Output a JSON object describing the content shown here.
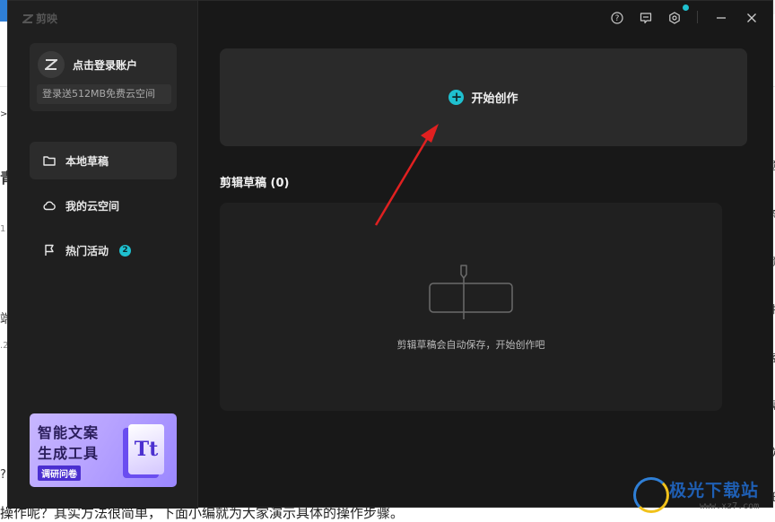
{
  "app": {
    "brand": "剪映",
    "login": {
      "title": "点击登录账户",
      "subtitle": "登录送512MB免费云空间"
    },
    "nav": [
      {
        "label": "本地草稿",
        "icon": "folder-icon"
      },
      {
        "label": "我的云空间",
        "icon": "cloud-icon"
      },
      {
        "label": "热门活动",
        "icon": "flag-icon",
        "badge": "2"
      }
    ],
    "promo": {
      "line1": "智能文案",
      "line2": "生成工具",
      "line3": "调研问卷",
      "glyph": "Tt"
    },
    "top_controls": [
      "help-icon",
      "feedback-icon",
      "settings-icon",
      "minimize-icon",
      "close-icon"
    ],
    "create": {
      "label": "开始创作"
    },
    "drafts": {
      "title": "剪辑草稿 (0)",
      "empty": "剪辑草稿会自动保存，开始创作吧"
    }
  },
  "background_page": {
    "bottom_text": "操作呢？其实方法很简单，下面小编就为大家演示具体的操作步骤。",
    "right_edge_chars": [
      "题",
      "条",
      "频",
      "件",
      "客",
      "视",
      "软",
      "任",
      "件",
      "器"
    ],
    "left_edge_chars": [
      ">",
      "青",
      "1",
      "端",
      ".2",
      "?"
    ]
  },
  "watermark": {
    "title": "极光下载站",
    "url": "www.xz7.com"
  },
  "colors": {
    "accent": "#1fc0cf",
    "window_bg": "#181818",
    "sidebar_bg": "#1f1f1f",
    "panel_bg": "#2a2a2a",
    "arrow": "#e02020"
  }
}
